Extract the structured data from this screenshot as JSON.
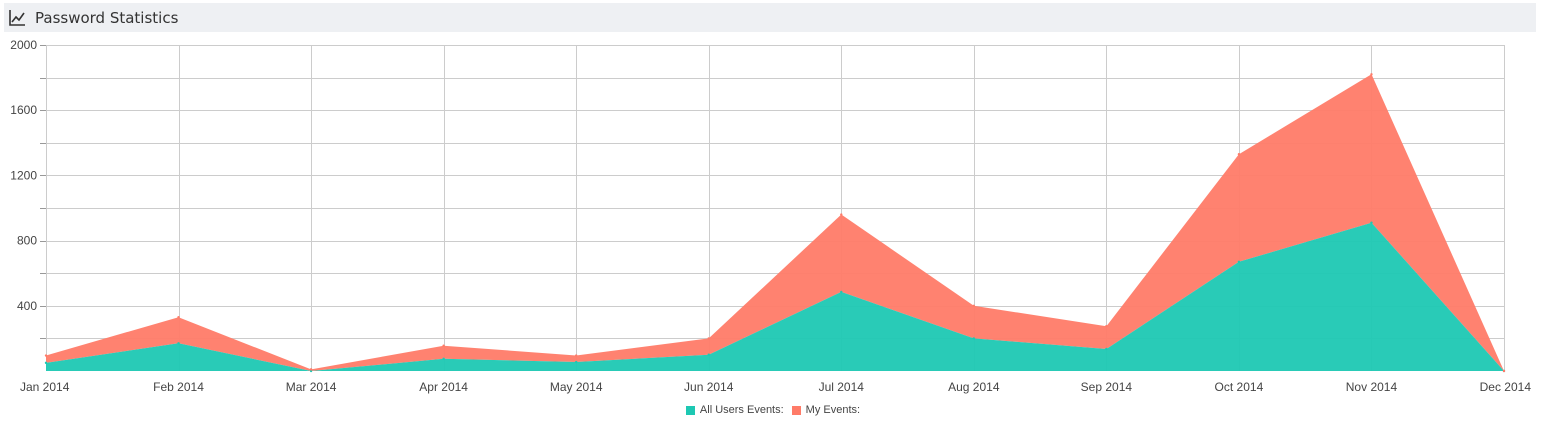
{
  "panel": {
    "title": "Password Statistics",
    "icon": "line-chart-icon"
  },
  "chart_data": {
    "type": "area",
    "stacked": true,
    "categories": [
      "Jan 2014",
      "Feb 2014",
      "Mar 2014",
      "Apr 2014",
      "May 2014",
      "Jun 2014",
      "Jul 2014",
      "Aug 2014",
      "Sep 2014",
      "Oct 2014",
      "Nov 2014",
      "Dec 2014"
    ],
    "series": [
      {
        "name": "All Users Events:",
        "color": "#1dc8b3",
        "values": [
          50,
          170,
          0,
          75,
          55,
          100,
          485,
          200,
          135,
          670,
          910,
          0
        ]
      },
      {
        "name": "My Events:",
        "color": "#ff7b68",
        "values": [
          45,
          160,
          10,
          80,
          40,
          100,
          475,
          200,
          140,
          660,
          910,
          0
        ]
      }
    ],
    "ylim": [
      0,
      2000
    ],
    "yticks": [
      400,
      800,
      1200,
      1600,
      2000
    ],
    "y_minor_step": 200,
    "grid": true
  }
}
